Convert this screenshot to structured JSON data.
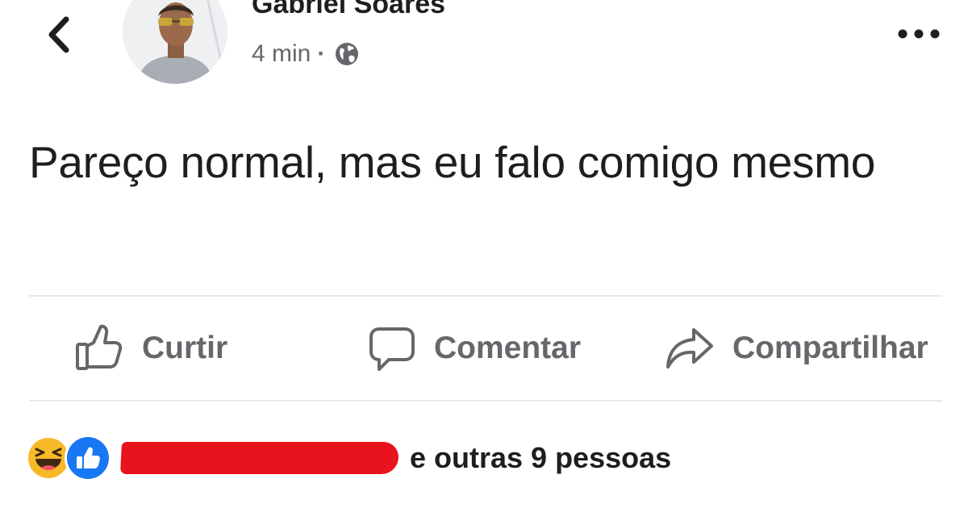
{
  "post": {
    "author": {
      "name": "Gabriel Soares"
    },
    "timestamp": "4 min",
    "separator": "·",
    "privacy_icon": "globe-icon",
    "text": "Pareço normal, mas eu falo comigo mesmo"
  },
  "actions": {
    "like_label": "Curtir",
    "comment_label": "Comentar",
    "share_label": "Compartilhar"
  },
  "reactions": {
    "icons": [
      "haha-icon",
      "like-reaction-icon"
    ],
    "others_text": "e outras 9 pessoas"
  },
  "colors": {
    "text": "#1c1e21",
    "secondary_text": "#65676b",
    "divider": "#e6e8eb",
    "like_blue": "#1877f2",
    "haha_yellow": "#f7b928",
    "redaction_red": "#e8131c"
  }
}
